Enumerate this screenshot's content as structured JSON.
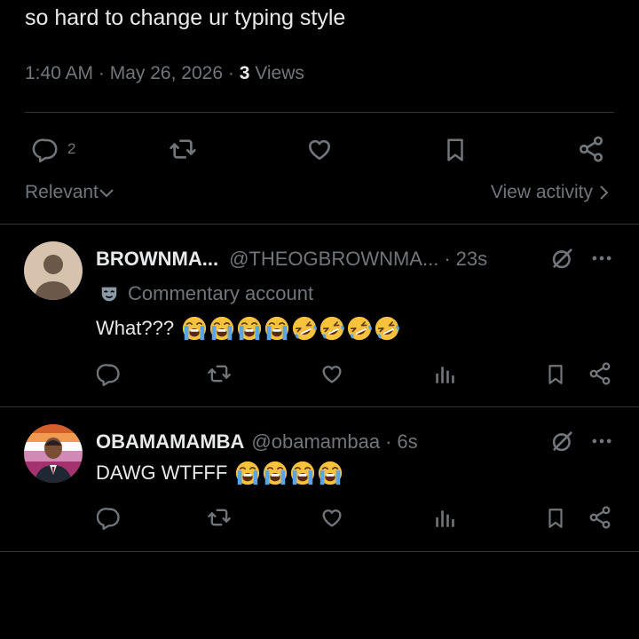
{
  "tweet": {
    "text": "so hard to change ur typing style",
    "time": "1:40 AM",
    "dot1": "·",
    "date": "May 26, 2026",
    "dot2": "·",
    "views_count": "3",
    "views_label": "Views",
    "reply_count": "2"
  },
  "filter": {
    "relevant_label": "Relevant",
    "view_activity_label": "View activity"
  },
  "replies": [
    {
      "name": "BROWNMA...",
      "handle": "@THEOGBROWNMA...",
      "dot": "·",
      "time": "23s",
      "commentary": "Commentary account",
      "text": "What???",
      "emojis": [
        "loudly-crying",
        "loudly-crying",
        "loudly-crying",
        "loudly-crying",
        "rofl",
        "rofl",
        "rofl",
        "rofl"
      ]
    },
    {
      "name": "OBAMAMAMBA",
      "handle": "@obamambaa",
      "dot": "·",
      "time": "6s",
      "text": "DAWG WTFFF",
      "emojis": [
        "loudly-crying",
        "loudly-crying",
        "loudly-crying",
        "loudly-crying"
      ]
    }
  ],
  "colors": {
    "background": "#000000",
    "text": "#e7e9ea",
    "muted": "#71767b",
    "divider": "#2f3336",
    "emoji_yellow": "#f9c23c",
    "tears_blue": "#5ba4e6"
  },
  "icons": {
    "reply": "reply-icon",
    "retweet": "retweet-icon",
    "like": "like-icon",
    "bookmark": "bookmark-icon",
    "share": "share-icon",
    "views": "views-icon",
    "grok": "grok-icon",
    "more": "more-icon",
    "mask": "theater-mask-icon"
  }
}
